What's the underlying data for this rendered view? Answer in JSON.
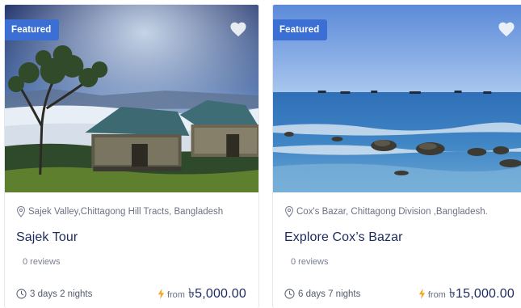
{
  "colors": {
    "badge": "#3b6fd4",
    "title": "#1d2b5c",
    "accent_bolt": "#f5a623",
    "meta_text": "#6d7186"
  },
  "cards": [
    {
      "badge": "Featured",
      "favorite_icon": "heart-icon",
      "location": "Sajek Valley,Chittagong Hill Tracts, Bangladesh",
      "title": "Sajek Tour",
      "reviews": "0 reviews",
      "duration": "3 days 2 nights",
      "price_prefix": "from",
      "price": "৳5,000.00",
      "image": "Wooden cottages on a hilltop above a sea of clouds"
    },
    {
      "badge": "Featured",
      "favorite_icon": "heart-icon",
      "location": "Cox's Bazar, Chittagong Division ,Bangladesh.",
      "title": "Explore Cox’s Bazar",
      "reviews": "0 reviews",
      "duration": "6 days 7 nights",
      "price_prefix": "from",
      "price": "৳15,000.00",
      "image": "Rocky beach shoreline with blue sea and sky"
    }
  ]
}
